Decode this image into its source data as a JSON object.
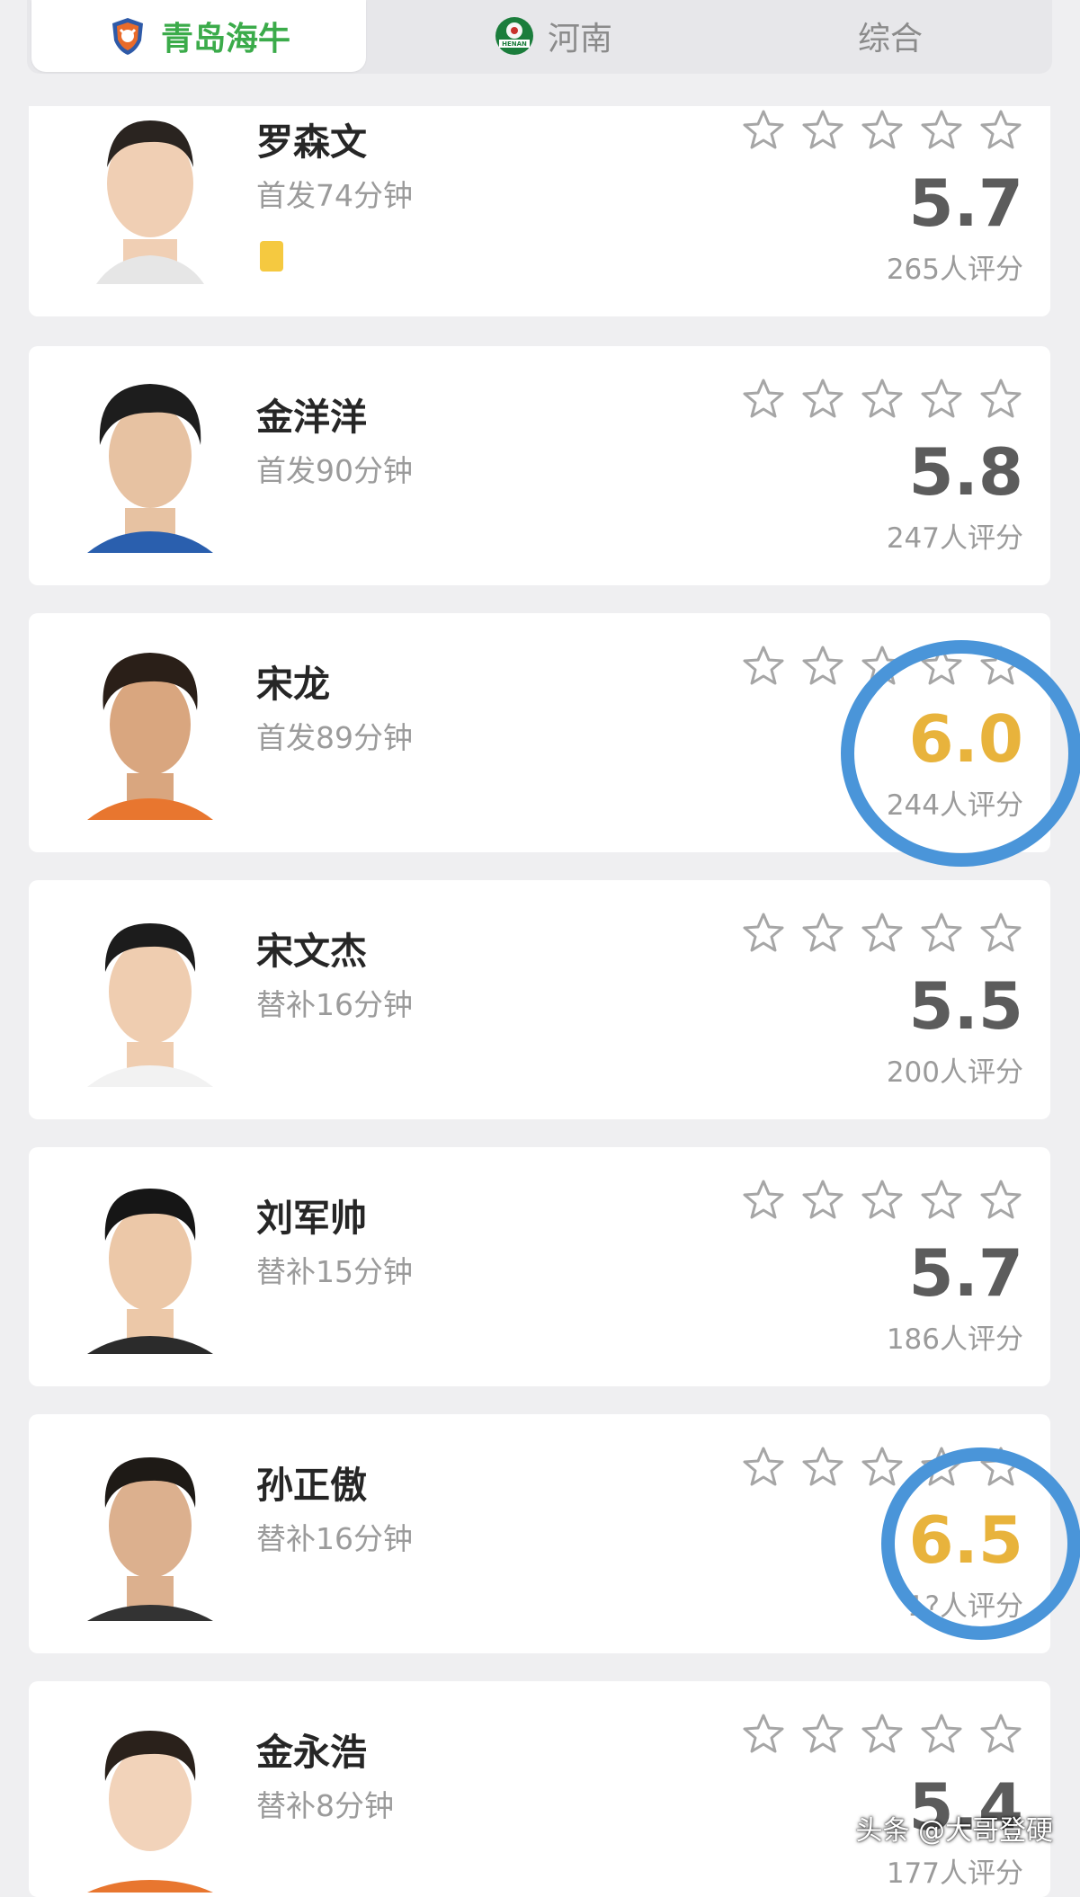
{
  "tabs": [
    {
      "label": "青岛海牛",
      "active": true,
      "icon": "qingdao-hainiu-badge"
    },
    {
      "label": "河南",
      "active": false,
      "icon": "henan-badge"
    },
    {
      "label": "综合",
      "active": false
    }
  ],
  "badge_text": {
    "henan": "HENAN"
  },
  "colors": {
    "active_tab": "#3bab4a",
    "score_highlight": "#e8b33c",
    "circle": "#4a95d9",
    "yellow_card": "#f5c940"
  },
  "players": [
    {
      "name": "罗森文",
      "meta": "首发74分钟",
      "score": "5.7",
      "count": "265人评分",
      "yellow_card": true,
      "highlight": false,
      "stars_filled": 0
    },
    {
      "name": "金洋洋",
      "meta": "首发90分钟",
      "score": "5.8",
      "count": "247人评分",
      "yellow_card": false,
      "highlight": false,
      "stars_filled": 0
    },
    {
      "name": "宋龙",
      "meta": "首发89分钟",
      "score": "6.0",
      "count": "244人评分",
      "yellow_card": false,
      "highlight": true,
      "stars_filled": 0
    },
    {
      "name": "宋文杰",
      "meta": "替补16分钟",
      "score": "5.5",
      "count": "200人评分",
      "yellow_card": false,
      "highlight": false,
      "stars_filled": 0
    },
    {
      "name": "刘军帅",
      "meta": "替补15分钟",
      "score": "5.7",
      "count": "186人评分",
      "yellow_card": false,
      "highlight": false,
      "stars_filled": 0
    },
    {
      "name": "孙正傲",
      "meta": "替补16分钟",
      "score": "6.5",
      "count": "1?人评分",
      "yellow_card": false,
      "highlight": true,
      "stars_filled": 0
    },
    {
      "name": "金永浩",
      "meta": "替补8分钟",
      "score": "5.4",
      "count": "177人评分",
      "yellow_card": false,
      "highlight": false,
      "stars_filled": 0
    }
  ],
  "watermark": "头条 @大哥登硬"
}
